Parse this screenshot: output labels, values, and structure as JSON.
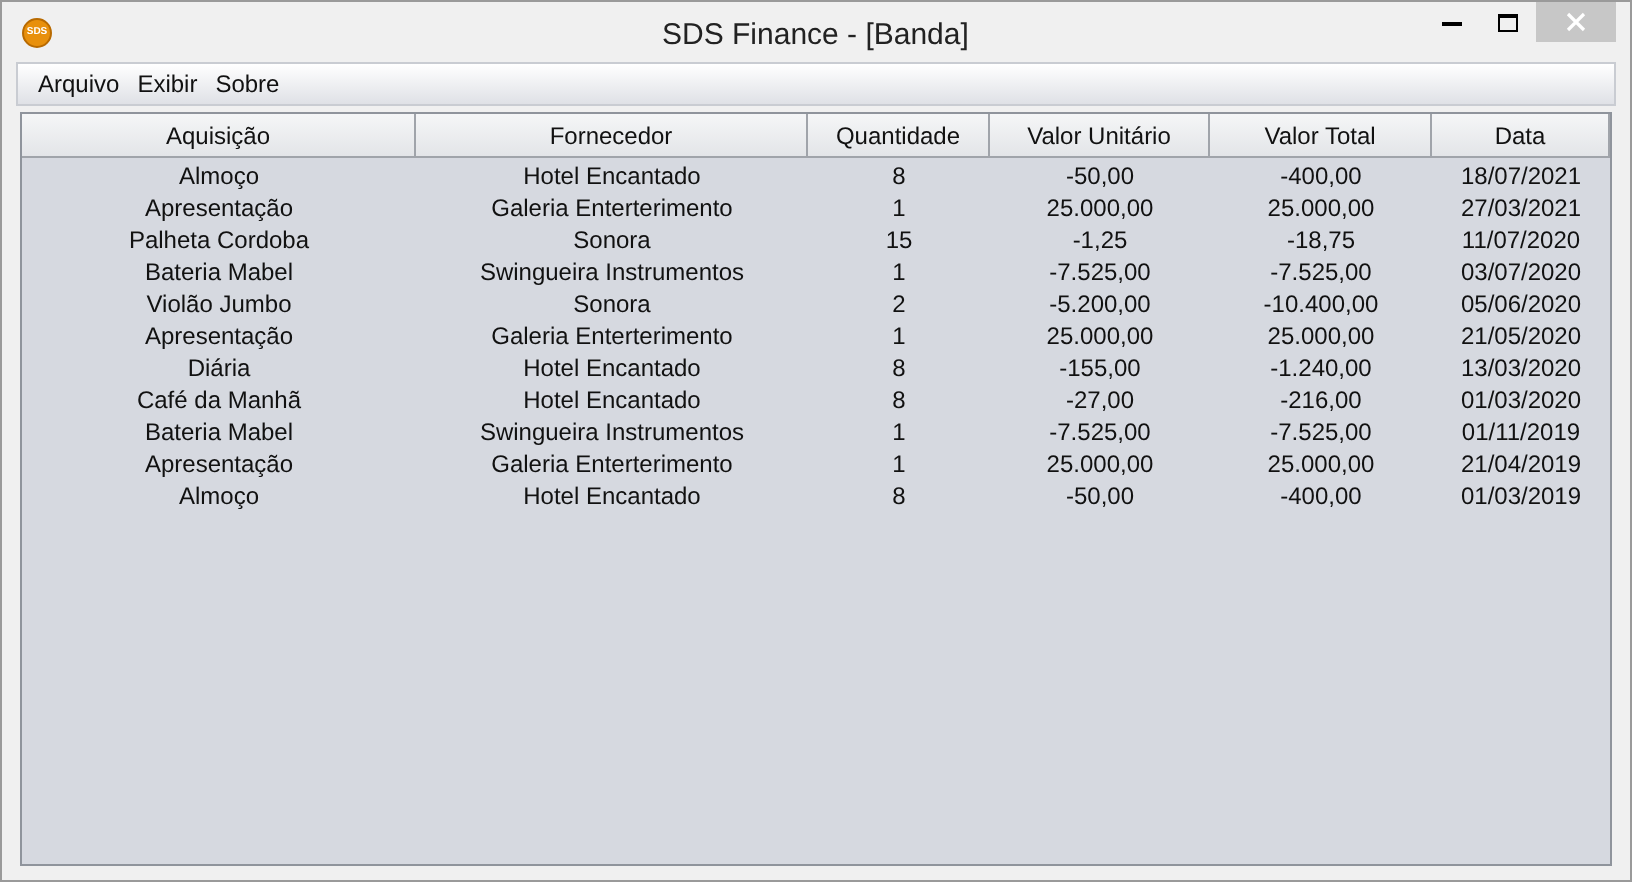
{
  "window": {
    "title": "SDS Finance - [Banda]",
    "logo": "SDS"
  },
  "menu": [
    "Arquivo",
    "Exibir",
    "Sobre"
  ],
  "table": {
    "columns": [
      "Aquisição",
      "Fornecedor",
      "Quantidade",
      "Valor Unitário",
      "Valor Total",
      "Data"
    ],
    "rows": [
      [
        "Almoço",
        "Hotel Encantado",
        "8",
        "-50,00",
        "-400,00",
        "18/07/2021"
      ],
      [
        "Apresentação",
        "Galeria Enterterimento",
        "1",
        "25.000,00",
        "25.000,00",
        "27/03/2021"
      ],
      [
        "Palheta Cordoba",
        "Sonora",
        "15",
        "-1,25",
        "-18,75",
        "11/07/2020"
      ],
      [
        "Bateria Mabel",
        "Swingueira Instrumentos",
        "1",
        "-7.525,00",
        "-7.525,00",
        "03/07/2020"
      ],
      [
        "Violão Jumbo",
        "Sonora",
        "2",
        "-5.200,00",
        "-10.400,00",
        "05/06/2020"
      ],
      [
        "Apresentação",
        "Galeria Enterterimento",
        "1",
        "25.000,00",
        "25.000,00",
        "21/05/2020"
      ],
      [
        "Diária",
        "Hotel Encantado",
        "8",
        "-155,00",
        "-1.240,00",
        "13/03/2020"
      ],
      [
        "Café da Manhã",
        "Hotel Encantado",
        "8",
        "-27,00",
        "-216,00",
        "01/03/2020"
      ],
      [
        "Bateria Mabel",
        "Swingueira Instrumentos",
        "1",
        "-7.525,00",
        "-7.525,00",
        "01/11/2019"
      ],
      [
        "Apresentação",
        "Galeria Enterterimento",
        "1",
        "25.000,00",
        "25.000,00",
        "21/04/2019"
      ],
      [
        "Almoço",
        "Hotel Encantado",
        "8",
        "-50,00",
        "-400,00",
        "01/03/2019"
      ]
    ]
  }
}
